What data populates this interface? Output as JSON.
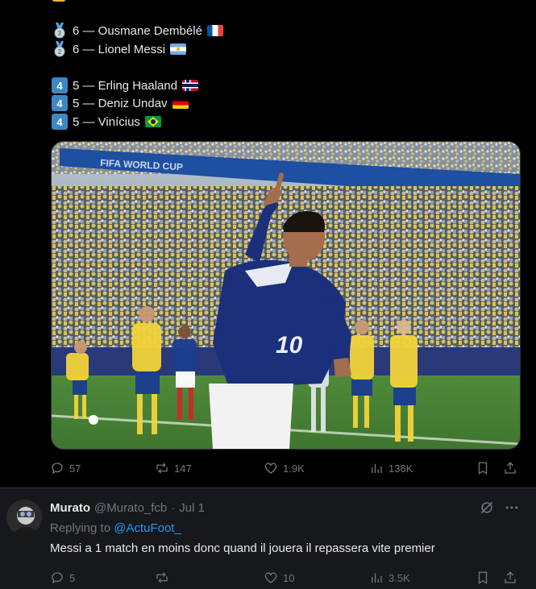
{
  "ranking": {
    "group_medal": [
      {
        "badge": "2",
        "text": "6 — Ousmane Dembélé",
        "flag": "fr"
      },
      {
        "badge": "2",
        "text": "6 — Lionel Messi",
        "flag": "ar"
      }
    ],
    "group_four": [
      {
        "badge": "4",
        "text": "5 — Erling Haaland",
        "flag": "no"
      },
      {
        "badge": "4",
        "text": "5 — Deniz Undav",
        "flag": "de"
      },
      {
        "badge": "4",
        "text": "5 — Vinícius",
        "flag": "br"
      }
    ]
  },
  "photo": {
    "banner_text": "FIFA WORLD CUP",
    "jersey_number": "10"
  },
  "tweet_actions": {
    "replies": "57",
    "reposts": "147",
    "likes": "1.9K",
    "views": "136K"
  },
  "reply": {
    "name": "Murato",
    "handle": "@Murato_fcb",
    "dot": "·",
    "date": "Jul 1",
    "replying_prefix": "Replying to",
    "replying_to": "@ActuFoot_",
    "text": "Messi a 1 match en moins donc quand il jouera il repassera vite premier",
    "actions": {
      "replies": "5",
      "reposts": "",
      "likes": "10",
      "views": "3.5K"
    }
  },
  "colors": {
    "background": "#000000",
    "reply_background": "#16181c",
    "text": "#e7e9ea",
    "muted": "#71767b",
    "link": "#1d9bf0",
    "border": "#2f3336",
    "keycap_blue": "#3b88c3"
  }
}
